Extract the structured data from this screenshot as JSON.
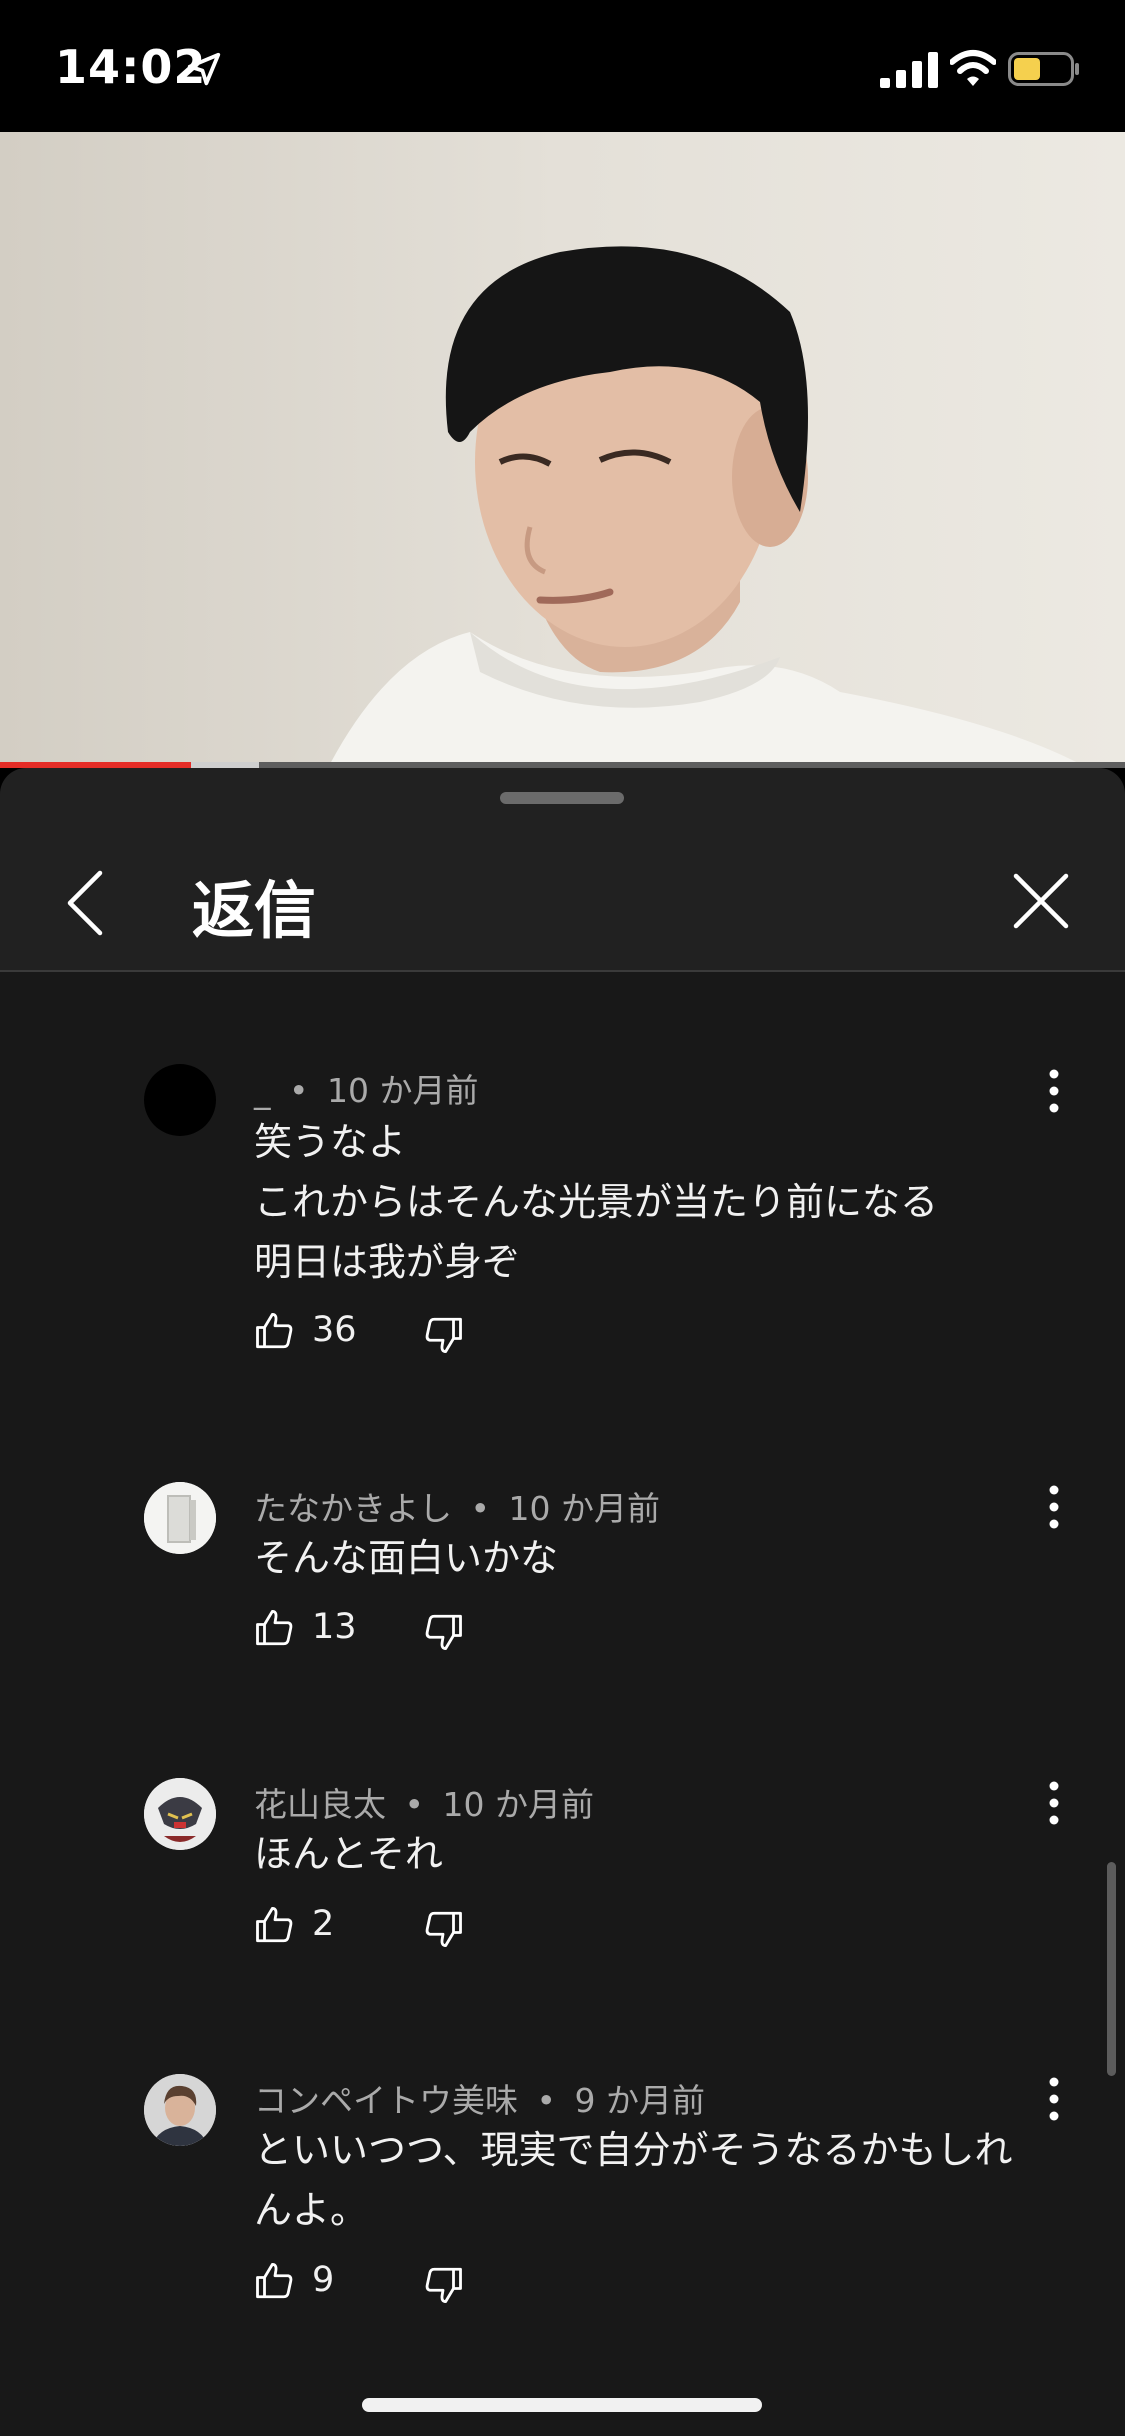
{
  "status_bar": {
    "time": "14:02",
    "icons": [
      "location-arrow-icon",
      "cellular-signal-icon",
      "wifi-icon",
      "battery-icon"
    ],
    "battery_color": "#f5d04e"
  },
  "video": {
    "progress_played": 0.17,
    "progress_buffered": 0.23,
    "progress_color": "#e52d27"
  },
  "sheet": {
    "title": "返信",
    "back_icon": "chevron-left-icon",
    "close_icon": "close-icon"
  },
  "comments": [
    {
      "author": "_",
      "time": "10 か月前",
      "lines": [
        "笑うなよ",
        "これからはそんな光景が当たり前になる",
        "明日は我が身ぞ"
      ],
      "likes": "36"
    },
    {
      "author": "たなかきよし",
      "time": "10 か月前",
      "lines": [
        "そんな面白いかな"
      ],
      "likes": "13"
    },
    {
      "author": "花山良太",
      "time": "10 か月前",
      "lines": [
        "ほんとそれ"
      ],
      "likes": "2"
    },
    {
      "author": "コンペイトウ美味",
      "time": "9 か月前",
      "lines": [
        "といいつつ、現実で自分がそうなるかもしれ",
        "んよ。"
      ],
      "likes": "9"
    }
  ],
  "separator": "•"
}
